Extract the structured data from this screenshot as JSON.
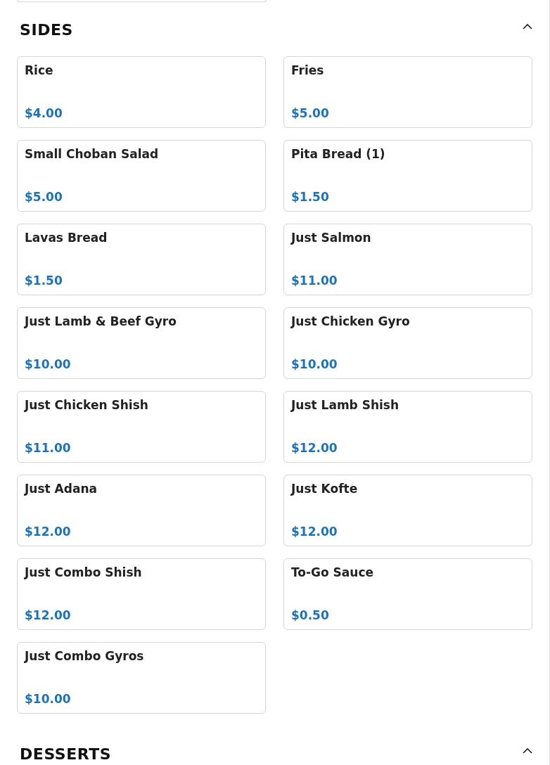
{
  "sections": [
    {
      "title": "SIDES",
      "expanded": true,
      "items": [
        {
          "name": "Rice",
          "price": "$4.00"
        },
        {
          "name": "Fries",
          "price": "$5.00"
        },
        {
          "name": "Small Choban Salad",
          "price": "$5.00"
        },
        {
          "name": "Pita Bread (1)",
          "price": "$1.50"
        },
        {
          "name": "Lavas Bread",
          "price": "$1.50"
        },
        {
          "name": "Just Salmon",
          "price": "$11.00"
        },
        {
          "name": "Just Lamb & Beef Gyro",
          "price": "$10.00"
        },
        {
          "name": "Just Chicken Gyro",
          "price": "$10.00"
        },
        {
          "name": "Just Chicken Shish",
          "price": "$11.00"
        },
        {
          "name": "Just Lamb Shish",
          "price": "$12.00"
        },
        {
          "name": "Just Adana",
          "price": "$12.00"
        },
        {
          "name": "Just Kofte",
          "price": "$12.00"
        },
        {
          "name": "Just Combo Shish",
          "price": "$12.00"
        },
        {
          "name": "To-Go Sauce",
          "price": "$0.50"
        },
        {
          "name": "Just Combo Gyros",
          "price": "$10.00"
        }
      ]
    },
    {
      "title": "DESSERTS",
      "expanded": true
    }
  ]
}
